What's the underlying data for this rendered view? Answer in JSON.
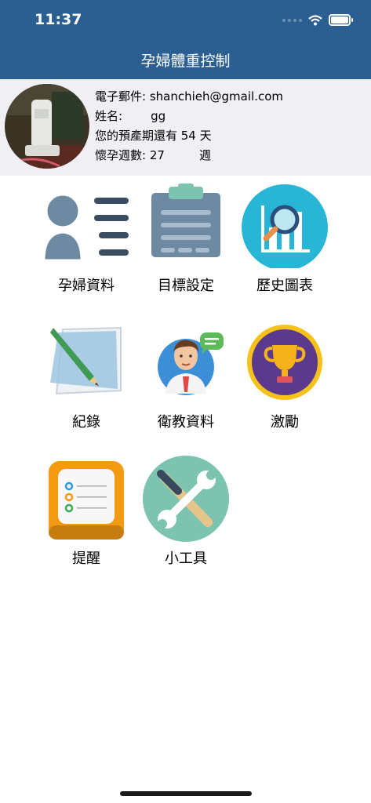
{
  "status_bar": {
    "time": "11:37"
  },
  "nav": {
    "title": "孕婦體重控制"
  },
  "profile": {
    "email_label": "電子郵件:",
    "email": "shanchieh@gmail.com",
    "name_label": "姓名:",
    "name": "gg",
    "due_text": "您的預產期還有 54 天",
    "weeks_label": "懷孕週數:",
    "weeks": "27",
    "weeks_unit": "週"
  },
  "menu": {
    "items": [
      {
        "label": "孕婦資料",
        "icon": "user-profile-icon"
      },
      {
        "label": "目標設定",
        "icon": "clipboard-icon"
      },
      {
        "label": "歷史圖表",
        "icon": "chart-magnifier-icon"
      },
      {
        "label": "紀錄",
        "icon": "notepad-pencil-icon"
      },
      {
        "label": "衛教資料",
        "icon": "doctor-chat-icon"
      },
      {
        "label": "激勵",
        "icon": "trophy-icon"
      },
      {
        "label": "提醒",
        "icon": "reminder-list-icon"
      },
      {
        "label": "小工具",
        "icon": "tools-icon"
      }
    ]
  },
  "colors": {
    "header": "#2c5f91",
    "profile_bg": "#efeff4",
    "teal": "#7cc4b0",
    "slate": "#6e8aa3"
  }
}
